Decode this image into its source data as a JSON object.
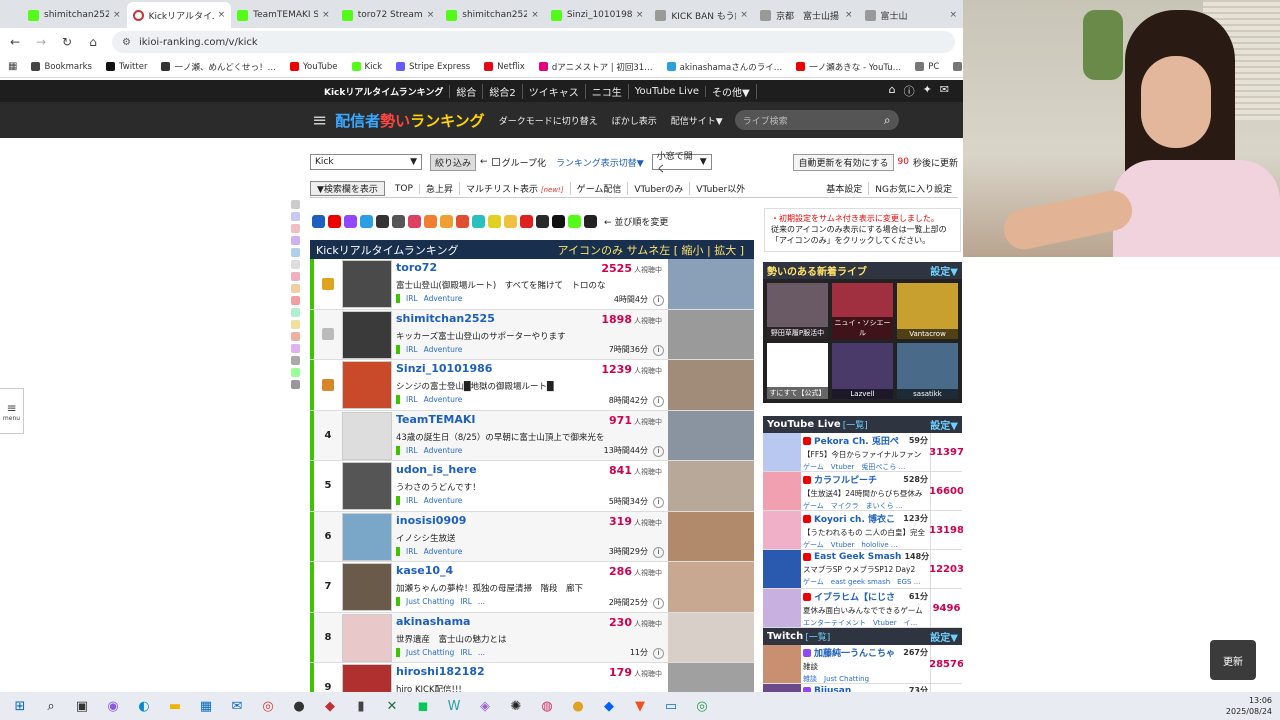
{
  "browser": {
    "tabs": [
      {
        "title": "shimitchan2525 S",
        "fav": "k",
        "active": false
      },
      {
        "title": "Kickリアルタイムラン",
        "fav": "r",
        "active": true
      },
      {
        "title": "TeamTEMAKI Stre",
        "fav": "k",
        "active": false
      },
      {
        "title": "toro72 Stream - V",
        "fav": "k",
        "active": false
      },
      {
        "title": "shimitchan2525 S",
        "fav": "k",
        "active": false
      },
      {
        "title": "Sinzi_10101986 S",
        "fav": "k",
        "active": false
      },
      {
        "title": "KICK BAN もう終わ",
        "fav": "f",
        "active": false
      },
      {
        "title": "京都　富士山揚",
        "fav": "f",
        "active": false
      },
      {
        "title": "富士山",
        "fav": "f",
        "active": false
      }
    ],
    "url": "ikioi-ranking.com/v/kick",
    "bookmarks": [
      {
        "label": "Bookmarks",
        "color": "#444"
      },
      {
        "label": "Twitter",
        "color": "#111"
      },
      {
        "label": "一ノ瀬、めんどくせっ！…",
        "color": "#333"
      },
      {
        "label": "YouTube",
        "color": "#e00"
      },
      {
        "label": "Kick",
        "color": "#53fc18"
      },
      {
        "label": "Stripe Express",
        "color": "#635bff"
      },
      {
        "label": "Netflix",
        "color": "#e50914"
      },
      {
        "label": "dアニメストア | 初回31…",
        "color": "#e4007f"
      },
      {
        "label": "akinashamaさんのライ…",
        "color": "#2aa0e0"
      },
      {
        "label": "一ノ瀬あきな - YouTu…",
        "color": "#e00"
      },
      {
        "label": "PC",
        "color": "#777"
      },
      {
        "label": "iCloud写真",
        "color": "#777"
      },
      {
        "label": "コス",
        "color": "#777"
      },
      {
        "label": "刑事各",
        "color": "#2a6bd0"
      }
    ]
  },
  "site": {
    "topnav": [
      "Kickリアルタイムランキング",
      "総合",
      "総合2",
      "ツイキャス",
      "ニコ生",
      "YouTube Live",
      "その他▼"
    ],
    "logo_a": "配信者",
    "logo_b": "勢い",
    "logo_c": "ランキング",
    "banner_links": [
      "ダークモードに切り替え",
      "ぼかし表示",
      "配信サイト▼"
    ],
    "search_placeholder": "ライブ検索",
    "ctrl1": {
      "select": "Kick",
      "filter_btn": "絞り込み",
      "arrow": "←",
      "group": "グループ化",
      "switch": "ランキング表示切替▼",
      "window_select": "小窓で開く",
      "auto_btn": "自動更新を有効にする",
      "sec": "90",
      "sec_suffix": "秒後に更新"
    },
    "ctrl2": {
      "search_toggle": "▼検索欄を表示",
      "items": [
        "TOP",
        "急上昇",
        "マルチリスト表示",
        "ゲーム配信",
        "VTuberのみ",
        "VTuber以外"
      ],
      "new": "[new!]",
      "right": [
        "基本設定",
        "NGお気に入り設定"
      ]
    },
    "sort_label": "← 並び順を変更",
    "ranking": {
      "title": "Kickリアルタイムランキング",
      "options": "アイコンのみ  サムネ左 [ 縮小 | 拡大 ]",
      "viewer_unit": "人視聴中",
      "rows": [
        {
          "rank": "",
          "crown": "g",
          "name": "toro72",
          "viewers": "2525",
          "title": "富士山登山(御殿場ルート)　すべてを賭けて　トロのな",
          "tags": [
            "IRL",
            "Adventure"
          ],
          "time": "4時間4分",
          "av": "#4a4a4a",
          "th": "#8aa0b8"
        },
        {
          "rank": "",
          "crown": "s",
          "name": "shimitchan2525",
          "viewers": "1898",
          "title": "キッカーズ富士山登山のサポーターやります",
          "tags": [
            "IRL",
            "Adventure"
          ],
          "time": "7時間36分",
          "av": "#3a3a3a",
          "th": "#9a9a9a"
        },
        {
          "rank": "",
          "crown": "b",
          "name": "Sinzi_10101986",
          "viewers": "1239",
          "title": "シンジの富士登山█地獄の御殿場ルート█",
          "tags": [
            "IRL",
            "Adventure"
          ],
          "time": "8時間42分",
          "av": "#c94a2a",
          "th": "#a08c78"
        },
        {
          "rank": "4",
          "crown": "",
          "name": "TeamTEMAKI",
          "viewers": "971",
          "title": "43歳の誕生日（8/25）の早朝に富士山頂上で御来光を",
          "tags": [
            "IRL",
            "Adventure"
          ],
          "time": "13時間44分",
          "av": "#ddd",
          "th": "#8a94a0"
        },
        {
          "rank": "5",
          "crown": "",
          "name": "udon_is_here",
          "viewers": "841",
          "title": "うわさのうどんです！",
          "tags": [
            "IRL",
            "Adventure"
          ],
          "time": "5時間34分",
          "av": "#555",
          "th": "#b8a89a"
        },
        {
          "rank": "6",
          "crown": "",
          "name": "inosisi0909",
          "viewers": "319",
          "title": "イノシシ生放送",
          "tags": [
            "IRL",
            "Adventure"
          ],
          "time": "3時間29分",
          "av": "#7aa6c8",
          "th": "#b08a6a"
        },
        {
          "rank": "7",
          "crown": "",
          "name": "kase10_4",
          "viewers": "286",
          "title": "加瀬ちゃんの夢枠！孤独の母屋清掃　階段　廊下",
          "tags": [
            "Just Chatting",
            "IRL",
            "..."
          ],
          "time": "2時間25分",
          "av": "#6a5a4a",
          "th": "#c8a890"
        },
        {
          "rank": "8",
          "crown": "",
          "name": "akinashama",
          "viewers": "230",
          "title": "世界遺産　富士山の魅力とは",
          "tags": [
            "Just Chatting",
            "IRL",
            "..."
          ],
          "time": "11分",
          "av": "#e8c8c8",
          "th": "#d8d0c8"
        },
        {
          "rank": "9",
          "crown": "",
          "name": "hiroshi182182",
          "viewers": "179",
          "title": "hiro KICK配信!!!",
          "tags": [
            "IRL"
          ],
          "time": "",
          "av": "#b03030",
          "th": "#a0a0a0"
        }
      ]
    },
    "notice_red": "・初期設定をサムネ付き表示に変更しました。",
    "notice_body": "従来のアイコンのみ表示にする場合は一覧上部の「アイコンのみ」をクリックしてください。",
    "new_live": {
      "title": "勢いのある新着ライブ",
      "set": "設定▼",
      "cells": [
        {
          "cap": "野田草履P服活中",
          "bg": "#6a5a66"
        },
        {
          "cap": "ニュイ・ソシエール",
          "bg": "#a03040"
        },
        {
          "cap": "Vantacrow",
          "bg": "#c8a030"
        },
        {
          "cap": "すにすて【公式】",
          "bg": "#ffffff"
        },
        {
          "cap": "Lazvell",
          "bg": "#4a3a6a"
        },
        {
          "cap": "sasatikk",
          "bg": "#4a6a8a"
        }
      ]
    },
    "youtube": {
      "title": "YouTube Live",
      "list_link": "[一覧]",
      "set": "設定▼",
      "rows": [
        {
          "name": "Pekora Ch. 兎田ぺ",
          "min": "59分",
          "title": "【FF5】今日からファイナルファン",
          "tags": "ゲーム　Vtuber　兎田ぺこら ...",
          "viewers": "31397",
          "av": "#b8c8f0"
        },
        {
          "name": "カラフルピーチ",
          "min": "528分",
          "title": "【生放送4】24時間からびち昼休み",
          "tags": "ゲーム　マイクラ　まいくら ...",
          "viewers": "16600",
          "av": "#f0a0b0"
        },
        {
          "name": "Koyori ch. 博衣こ",
          "min": "123分",
          "title": "【うたわれるもの 二人の白皇】完全",
          "tags": "ゲーム　Vtuber　hololive ...",
          "viewers": "13198",
          "av": "#f0b0c8"
        },
        {
          "name": "East Geek Smash",
          "min": "148分",
          "title": "スマブラSP ウメブラSP12 Day2",
          "tags": "ゲーム　east geek smash　EGS ...",
          "viewers": "12203",
          "av": "#2a5ab0"
        },
        {
          "name": "イブラヒム【にじさ",
          "min": "61分",
          "title": "夏休み面白いみんなでできるゲーム",
          "tags": "エンターテイメント　Vtuber　イ...",
          "viewers": "9496",
          "av": "#c8b0e0"
        }
      ]
    },
    "twitch": {
      "title": "Twitch",
      "list_link": "[一覧]",
      "set": "設定▼",
      "rows": [
        {
          "name": "加藤純一うんこちゃ",
          "min": "267分",
          "title": "雑談",
          "tags": "雑談　Just Chatting",
          "viewers": "28576",
          "av": "#c89070"
        },
        {
          "name": "Bijusan",
          "min": "73分",
          "title": "",
          "tags": "",
          "viewers": "",
          "av": "#6a4a8a"
        }
      ]
    },
    "update_btn": "更新",
    "menu_label": "menu"
  },
  "taskbar": {
    "icons": [
      {
        "name": "start-icon",
        "glyph": "⊞",
        "color": "#0067c0"
      },
      {
        "name": "search-icon",
        "glyph": "⌕",
        "color": "#222"
      },
      {
        "name": "taskview-icon",
        "glyph": "▣",
        "color": "#333"
      },
      {
        "name": "copilot-icon",
        "glyph": "◉",
        "color": "#8a5ae0"
      },
      {
        "name": "edge-icon",
        "glyph": "◐",
        "color": "#0a8ad0"
      },
      {
        "name": "folder-icon",
        "glyph": "▬",
        "color": "#f0b400"
      },
      {
        "name": "store-icon",
        "glyph": "▦",
        "color": "#0067c0"
      },
      {
        "name": "outlook-icon",
        "glyph": "✉",
        "color": "#0a64c8"
      },
      {
        "name": "chrome-icon",
        "glyph": "◎",
        "color": "#d04030"
      },
      {
        "name": "obs-icon",
        "glyph": "●",
        "color": "#333"
      },
      {
        "name": "app-red-icon",
        "glyph": "◆",
        "color": "#c03030"
      },
      {
        "name": "ncv-icon",
        "glyph": "▮",
        "color": "#444"
      },
      {
        "name": "excel-icon",
        "glyph": "✕",
        "color": "#1d7044"
      },
      {
        "name": "line-icon",
        "glyph": "◼",
        "color": "#06c755"
      },
      {
        "name": "w-icon",
        "glyph": "W",
        "color": "#2aa0a0"
      },
      {
        "name": "app-purple-icon",
        "glyph": "◈",
        "color": "#a060d0"
      },
      {
        "name": "chatgpt-icon",
        "glyph": "✺",
        "color": "#222"
      },
      {
        "name": "app-pink-icon",
        "glyph": "◍",
        "color": "#d03060"
      },
      {
        "name": "coin-icon",
        "glyph": "●",
        "color": "#e0a020"
      },
      {
        "name": "dropbox-icon",
        "glyph": "◆",
        "color": "#0061fe"
      },
      {
        "name": "brave-icon",
        "glyph": "▼",
        "color": "#f05020"
      },
      {
        "name": "monitor-icon",
        "glyph": "▭",
        "color": "#0a6ad0"
      },
      {
        "name": "chrome2-icon",
        "glyph": "◎",
        "color": "#2a9a4a"
      }
    ],
    "time": "13:06",
    "date": "2025/08/24"
  }
}
